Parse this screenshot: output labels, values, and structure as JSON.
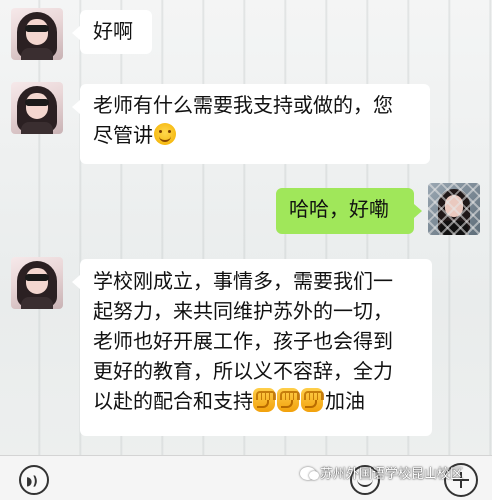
{
  "messages": [
    {
      "side": "left",
      "lines": [
        "好啊"
      ]
    },
    {
      "side": "left",
      "lines": [
        "老师有什么需要我支持或做的，您",
        "尽管讲"
      ],
      "trailing_emoji": "smile-emoji"
    },
    {
      "side": "right",
      "lines": [
        "哈哈，好嘞"
      ]
    },
    {
      "side": "left",
      "lines": [
        "学校刚成立，事情多，需要我们一",
        "起努力，来共同维护苏外的一切，",
        "老师也好开展工作，孩子也会得到",
        "更好的教育，所以义不容辞，全力",
        "以赴的配合和支持"
      ],
      "fists": 3,
      "tail_text": "加油"
    }
  ],
  "icons": {
    "voice": "voice-icon",
    "emoji": "emoji-icon",
    "plus": "plus-icon",
    "smile": "smile-emoji",
    "fist": "fist-emoji",
    "watermark": "wechat-logo-icon"
  },
  "watermark_text": "苏州外国语学校昆山校区",
  "colors": {
    "sent_bubble": "#a0e75a",
    "received_bubble": "#ffffff"
  }
}
